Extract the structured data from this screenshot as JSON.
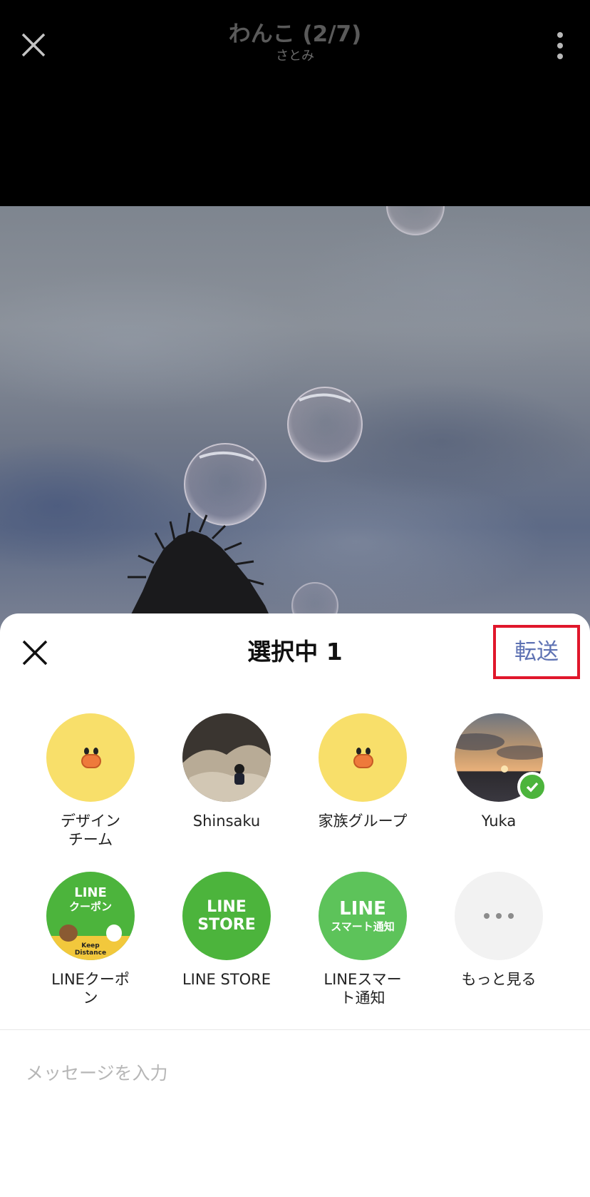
{
  "viewer": {
    "title": "わんこ (2/7)",
    "subtitle": "さとみ"
  },
  "share_sheet": {
    "title": "選択中 1",
    "forward_label": "転送",
    "highlight_color": "#e0172b",
    "message_placeholder": "メッセージを入力",
    "friends": [
      {
        "name": "デザイン\nチーム",
        "avatar": "sally-icon",
        "selected": false
      },
      {
        "name": "Shinsaku",
        "avatar": "person-photo",
        "selected": false
      },
      {
        "name": "家族グループ",
        "avatar": "sally-icon",
        "selected": false
      },
      {
        "name": "Yuka",
        "avatar": "sunset-photo",
        "selected": true
      },
      {
        "name": "LINEクーポ\nン",
        "avatar": "line-coupon-logo",
        "avatar_text": [
          "LINE",
          "クーポン",
          "Keep",
          "Distance"
        ],
        "selected": false
      },
      {
        "name": "LINE STORE",
        "avatar": "line-store-logo",
        "avatar_text": [
          "LINE",
          "STORE"
        ],
        "selected": false
      },
      {
        "name": "LINEスマー\nト通知",
        "avatar": "line-smart-notice-logo",
        "avatar_text": [
          "LINE",
          "スマート通知"
        ],
        "selected": false
      },
      {
        "name": "もっと見る",
        "avatar": "more-icon",
        "selected": false
      }
    ]
  },
  "colors": {
    "line_green": "#4cb43c",
    "forward_text": "#5e72b3",
    "sally_yellow": "#f8df6a"
  }
}
